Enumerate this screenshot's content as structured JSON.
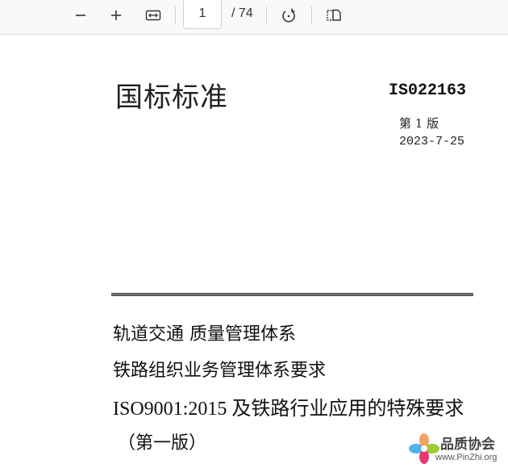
{
  "toolbar": {
    "current_page": "1",
    "page_total": "/ 74",
    "icons": [
      "zoom-out-icon",
      "zoom-in-icon",
      "fit-width-icon",
      "rotate-icon",
      "page-view-icon"
    ]
  },
  "document": {
    "title": "国标标准",
    "number": "IS022163",
    "edition": "第 1 版",
    "date": "2023-7-25",
    "subtitle_lines": [
      "轨道交通  质量管理体系",
      "铁路组织业务管理体系要求",
      "ISO9001:2015 及铁路行业应用的特殊要求",
      "（第一版）"
    ]
  },
  "watermark": {
    "name": "品质协会",
    "url": "www.PinZhi.org"
  },
  "colors": {
    "toolbar_bg": "#f9f9f9",
    "rule": "#7a7a7a",
    "text": "#111111"
  }
}
